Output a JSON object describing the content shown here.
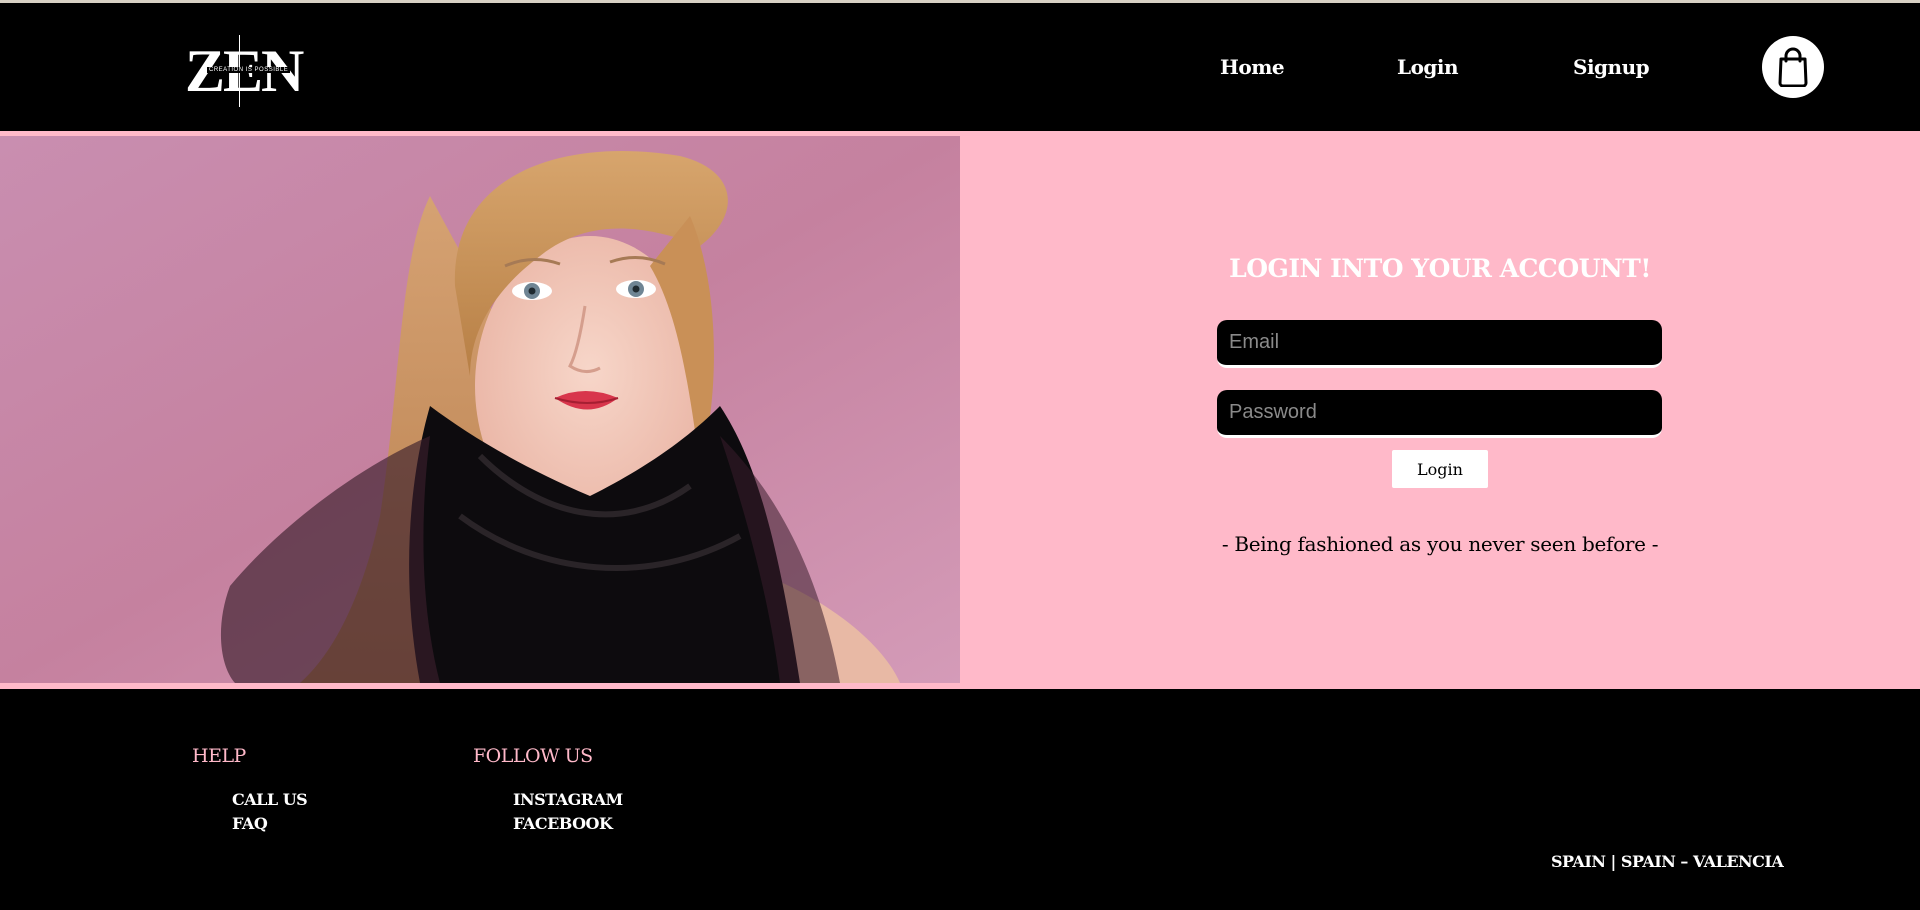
{
  "brand": {
    "logo_text": "ZEN",
    "logo_tagline": "CREATION IS POSSIBLE"
  },
  "nav": {
    "home": "Home",
    "login": "Login",
    "signup": "Signup",
    "cart_icon": "shopping-bag-icon"
  },
  "login_form": {
    "title": "LOGIN INTO YOUR ACCOUNT!",
    "email_placeholder": "Email",
    "email_value": "",
    "password_placeholder": "Password",
    "password_value": "",
    "submit_label": "Login",
    "tagline": "- Being fashioned as you never seen before -"
  },
  "footer": {
    "help_heading": "HELP",
    "help_links": [
      "CALL US",
      "FAQ"
    ],
    "follow_heading": "FOLLOW US",
    "follow_links": [
      "INSTAGRAM",
      "FACEBOOK"
    ],
    "location": "SPAIN | SPAIN – VALENCIA"
  },
  "colors": {
    "background": "#000000",
    "accent_pink": "#ffb9c9",
    "photo_backdrop": "#c886a8",
    "text_light": "#ffffff"
  }
}
